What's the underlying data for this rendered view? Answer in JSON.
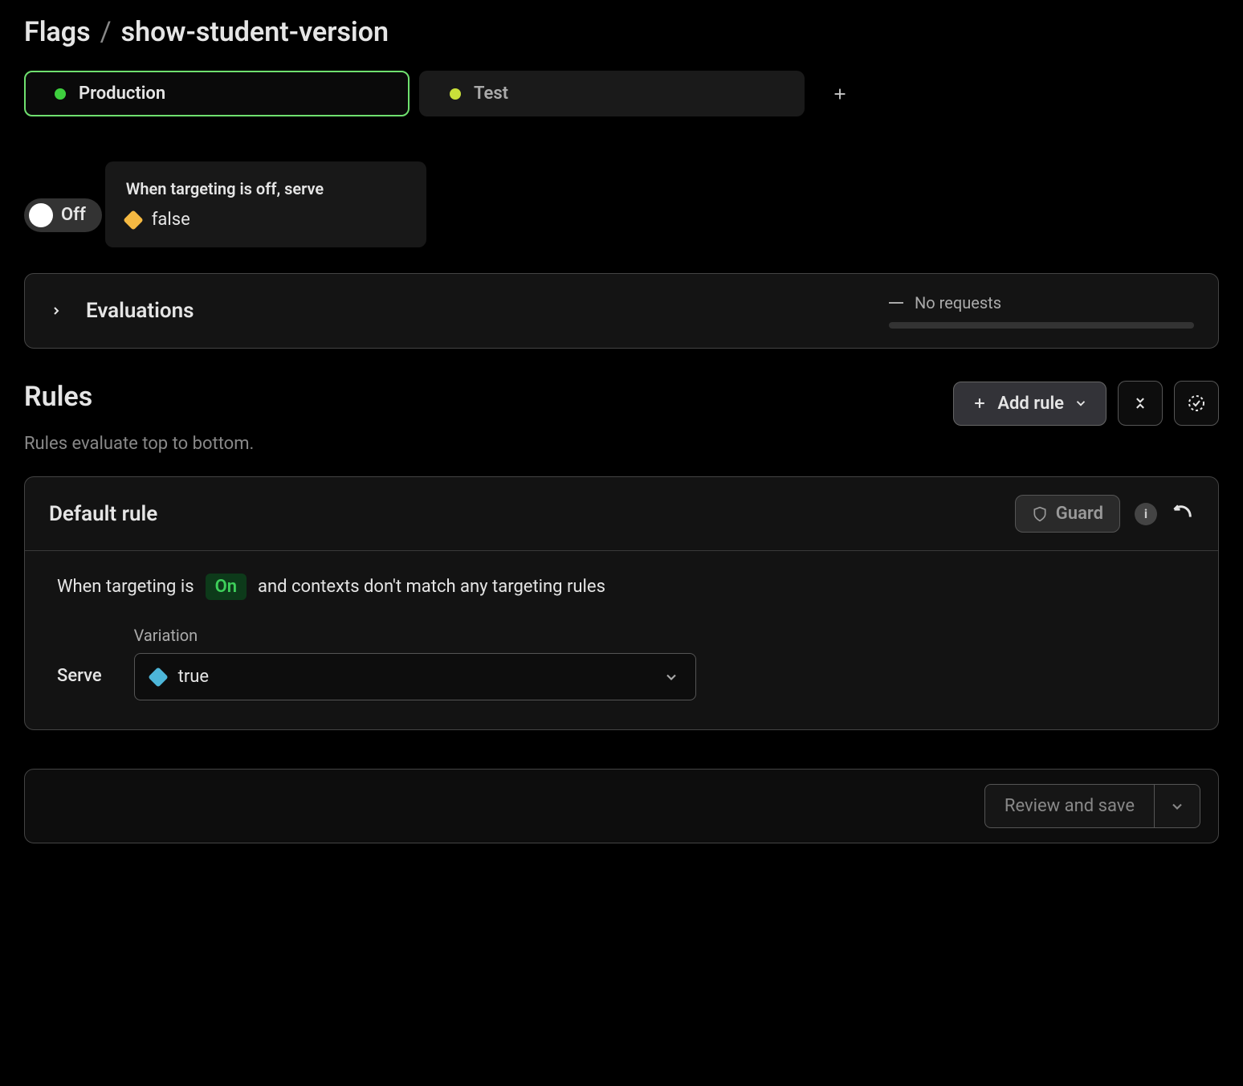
{
  "breadcrumb": {
    "parent": "Flags",
    "separator": "/",
    "current": "show-student-version"
  },
  "environments": {
    "tabs": [
      {
        "label": "Production",
        "dotColor": "green",
        "active": true
      },
      {
        "label": "Test",
        "dotColor": "lime",
        "active": false
      }
    ]
  },
  "toggle": {
    "state_label": "Off"
  },
  "off_serve": {
    "title": "When targeting is off, serve",
    "value": "false"
  },
  "evaluations": {
    "title": "Evaluations",
    "status": "No requests"
  },
  "rules": {
    "title": "Rules",
    "subtitle": "Rules evaluate top to bottom.",
    "add_label": "Add rule"
  },
  "default_rule": {
    "title": "Default rule",
    "guard_label": "Guard",
    "condition_prefix": "When targeting is",
    "condition_badge": "On",
    "condition_suffix": "and contexts don't match any targeting rules",
    "serve_label": "Serve",
    "variation_label": "Variation",
    "variation_value": "true"
  },
  "footer": {
    "review_label": "Review and save"
  }
}
